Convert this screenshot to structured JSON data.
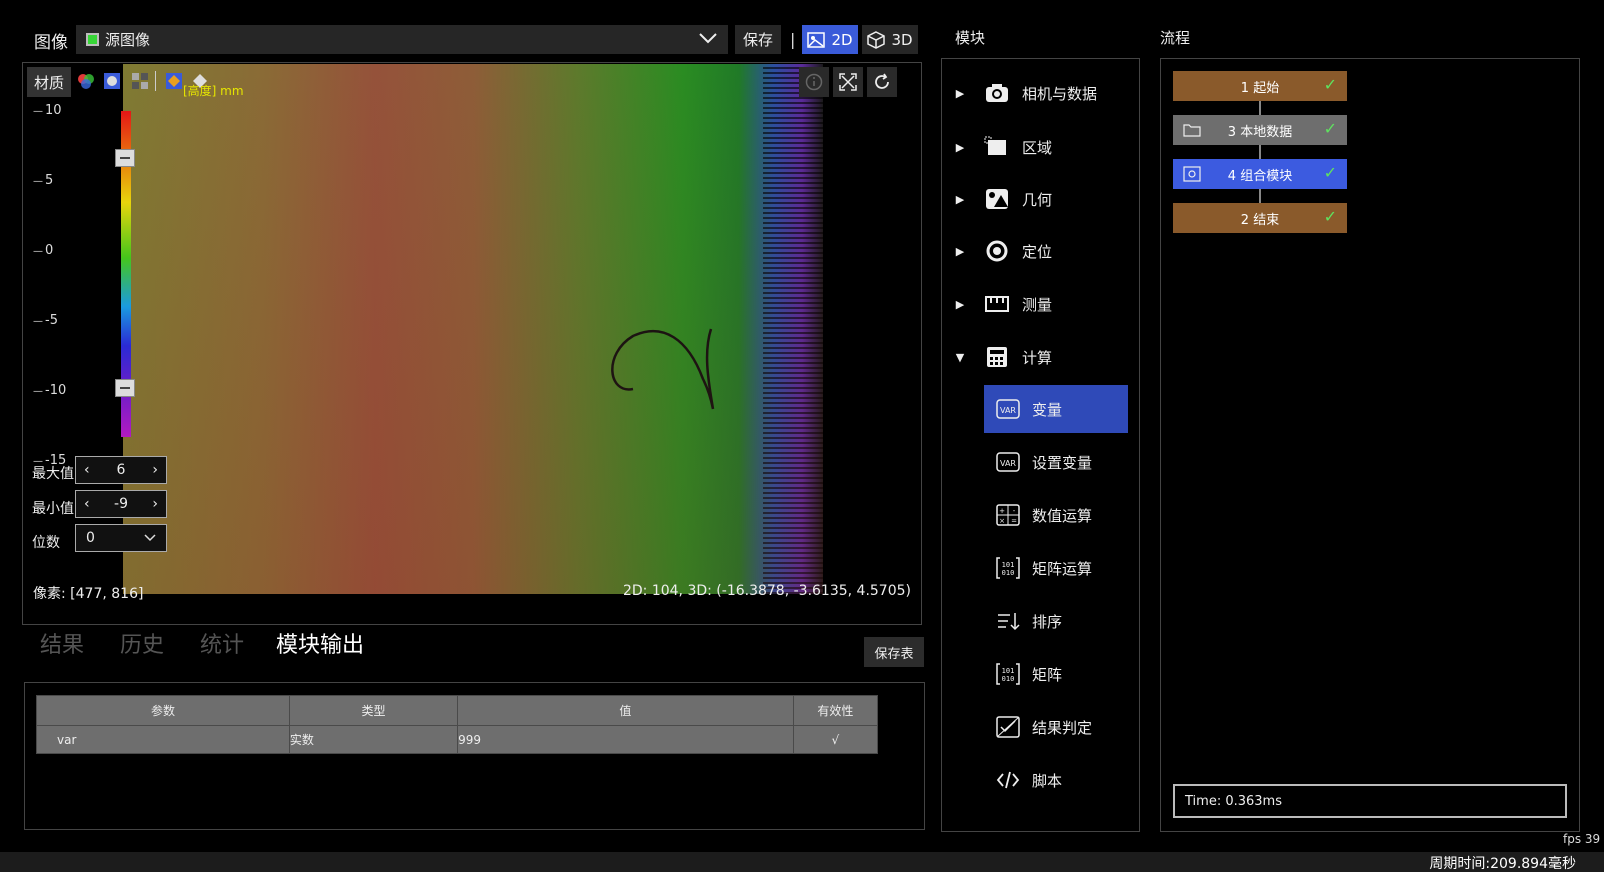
{
  "image_header": {
    "title": "图像",
    "source": "源图像",
    "save_label": "保存",
    "separator": "|",
    "btn_2d": "2D",
    "btn_3d": "3D"
  },
  "viewer": {
    "material_label": "材质",
    "unit_label": "[高度] mm",
    "colorbar_ticks": [
      "10",
      "5",
      "0",
      "-5",
      "-10",
      "-15"
    ],
    "max_label": "最大值",
    "max_value": "6",
    "min_label": "最小值",
    "min_value": "-9",
    "digits_label": "位数",
    "digits_value": "0",
    "pixel_status": "像素: [477, 816]",
    "coord_status": "2D: 104, 3D: (-16.3878, -3.6135, 4.5705)"
  },
  "tabs": [
    {
      "label": "结果"
    },
    {
      "label": "历史"
    },
    {
      "label": "统计"
    },
    {
      "label": "模块输出"
    }
  ],
  "save_table_label": "保存表",
  "table": {
    "headers": [
      "参数",
      "类型",
      "值",
      "有效性"
    ],
    "rows": [
      [
        "var",
        "实数",
        "999",
        "√"
      ]
    ]
  },
  "modules": {
    "title": "模块",
    "categories": [
      {
        "label": "相机与数据",
        "icon": "camera-icon"
      },
      {
        "label": "区域",
        "icon": "region-icon"
      },
      {
        "label": "几何",
        "icon": "geometry-icon"
      },
      {
        "label": "定位",
        "icon": "locate-icon"
      },
      {
        "label": "测量",
        "icon": "ruler-icon"
      },
      {
        "label": "计算",
        "icon": "calculator-icon"
      }
    ],
    "sub_items": [
      {
        "label": "变量",
        "icon": "var-icon"
      },
      {
        "label": "设置变量",
        "icon": "set-var-icon"
      },
      {
        "label": "数值运算",
        "icon": "math-icon"
      },
      {
        "label": "矩阵运算",
        "icon": "matrix-op-icon"
      },
      {
        "label": "排序",
        "icon": "sort-icon"
      },
      {
        "label": "矩阵",
        "icon": "matrix-icon"
      },
      {
        "label": "结果判定",
        "icon": "judge-icon"
      },
      {
        "label": "脚本",
        "icon": "script-icon"
      }
    ]
  },
  "flow": {
    "title": "流程",
    "nodes": [
      {
        "label": "1 起始",
        "color": "#8a5a2b"
      },
      {
        "label": "3 本地数据",
        "color": "#6e6e6e"
      },
      {
        "label": "4 组合模块",
        "color": "#3c5be0"
      },
      {
        "label": "2 结束",
        "color": "#8a5a2b"
      }
    ],
    "time": "Time: 0.363ms"
  },
  "fps": "fps 39",
  "cycle_time": "周期时间:209.894毫秒"
}
